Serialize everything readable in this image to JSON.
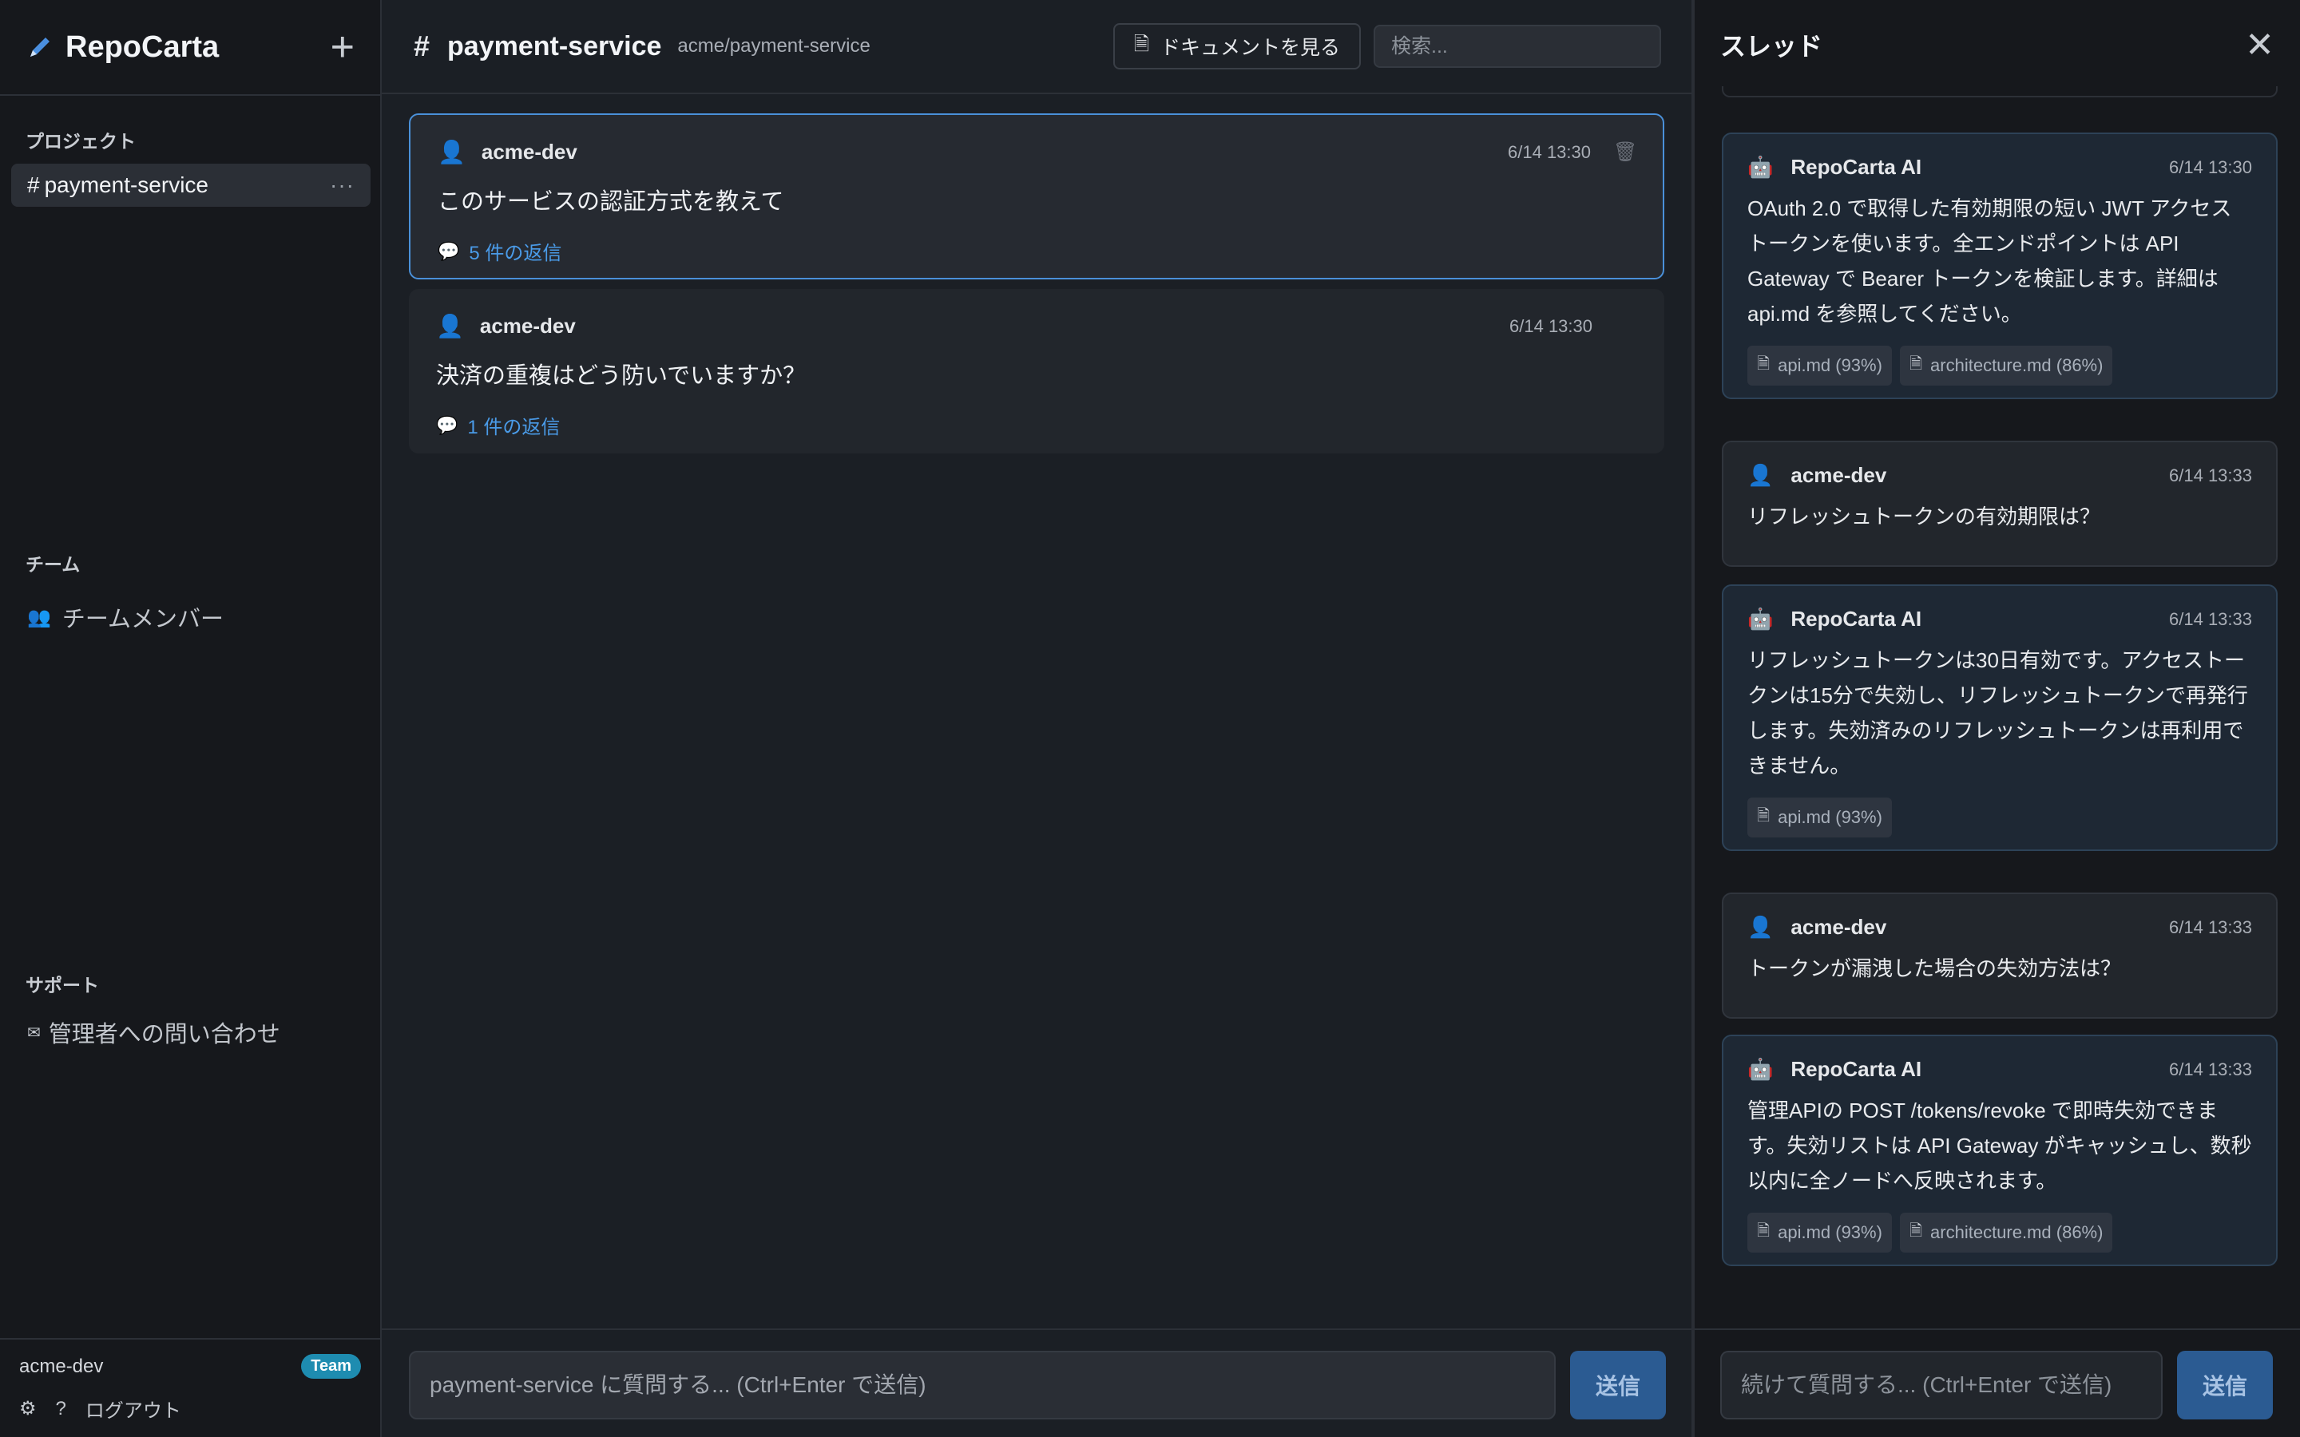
{
  "app": {
    "title": "RepoCarta",
    "add_label": "+"
  },
  "sidebar": {
    "projects_title": "プロジェクト",
    "project": {
      "hash": "#",
      "name": "payment-service",
      "more": "···"
    },
    "team_title": "チーム",
    "team_item": "チームメンバー",
    "support_title": "サポート",
    "support_item": "管理者への問い合わせ",
    "user": "acme-dev",
    "plan_badge": "Team",
    "settings_icon": "⚙",
    "help_label": "?",
    "logout_label": "ログアウト"
  },
  "main": {
    "channel_hash": "#",
    "channel_name": "payment-service",
    "repo": "acme/payment-service",
    "docs_button": "ドキュメントを見る",
    "search_placeholder": "検索...",
    "messages": [
      {
        "author": "acme-dev",
        "time": "6/14 13:30",
        "text": "このサービスの認証方式を教えて",
        "replies": "5 件の返信"
      },
      {
        "author": "acme-dev",
        "time": "6/14 13:30",
        "text": "決済の重複はどう防いでいますか？",
        "replies": "1 件の返信"
      }
    ],
    "composer_placeholder": "payment-service に質問する... (Ctrl+Enter で送信)",
    "send_label": "送信"
  },
  "thread": {
    "title": "スレッド",
    "close_label": "✕",
    "messages": [
      {
        "author": "RepoCarta AI",
        "time": "6/14 13:30",
        "text": "OAuth 2.0 で取得した有効期限の短い JWT アクセストークンを使います。全エンドポイントは API Gateway で Bearer トークンを検証します。詳細は api.md を参照してください。",
        "sources": [
          "api.md (93%)",
          "architecture.md (86%)"
        ]
      },
      {
        "author": "acme-dev",
        "time": "6/14 13:33",
        "text": "リフレッシュトークンの有効期限は？"
      },
      {
        "author": "RepoCarta AI",
        "time": "6/14 13:33",
        "text": "リフレッシュトークンは30日有効です。アクセストークンは15分で失効し、リフレッシュトークンで再発行します。失効済みのリフレッシュトークンは再利用できません。",
        "sources": [
          "api.md (93%)"
        ]
      },
      {
        "author": "acme-dev",
        "time": "6/14 13:33",
        "text": "トークンが漏洩した場合の失効方法は？"
      },
      {
        "author": "RepoCarta AI",
        "time": "6/14 13:33",
        "text": "管理APIの POST /tokens/revoke で即時失効できます。失効リストは API Gateway がキャッシュし、数秒以内に全ノードへ反映されます。",
        "sources": [
          "api.md (93%)",
          "architecture.md (86%)"
        ]
      }
    ],
    "composer_placeholder": "続けて質問する... (Ctrl+Enter で送信)",
    "send_label": "送信"
  },
  "colors": {
    "accent": "#4a90d9",
    "link": "#4a9be8",
    "badge": "#1e8cb0",
    "send_button": "#2b5b92"
  },
  "icons": {
    "logo": "pencil-logo-icon",
    "user": "user-icon",
    "bot": "robot-icon",
    "team": "people-icon",
    "mail": "mail-icon",
    "doc": "file-icon",
    "comment": "speech-bubble-icon",
    "trash": "trash-icon"
  }
}
